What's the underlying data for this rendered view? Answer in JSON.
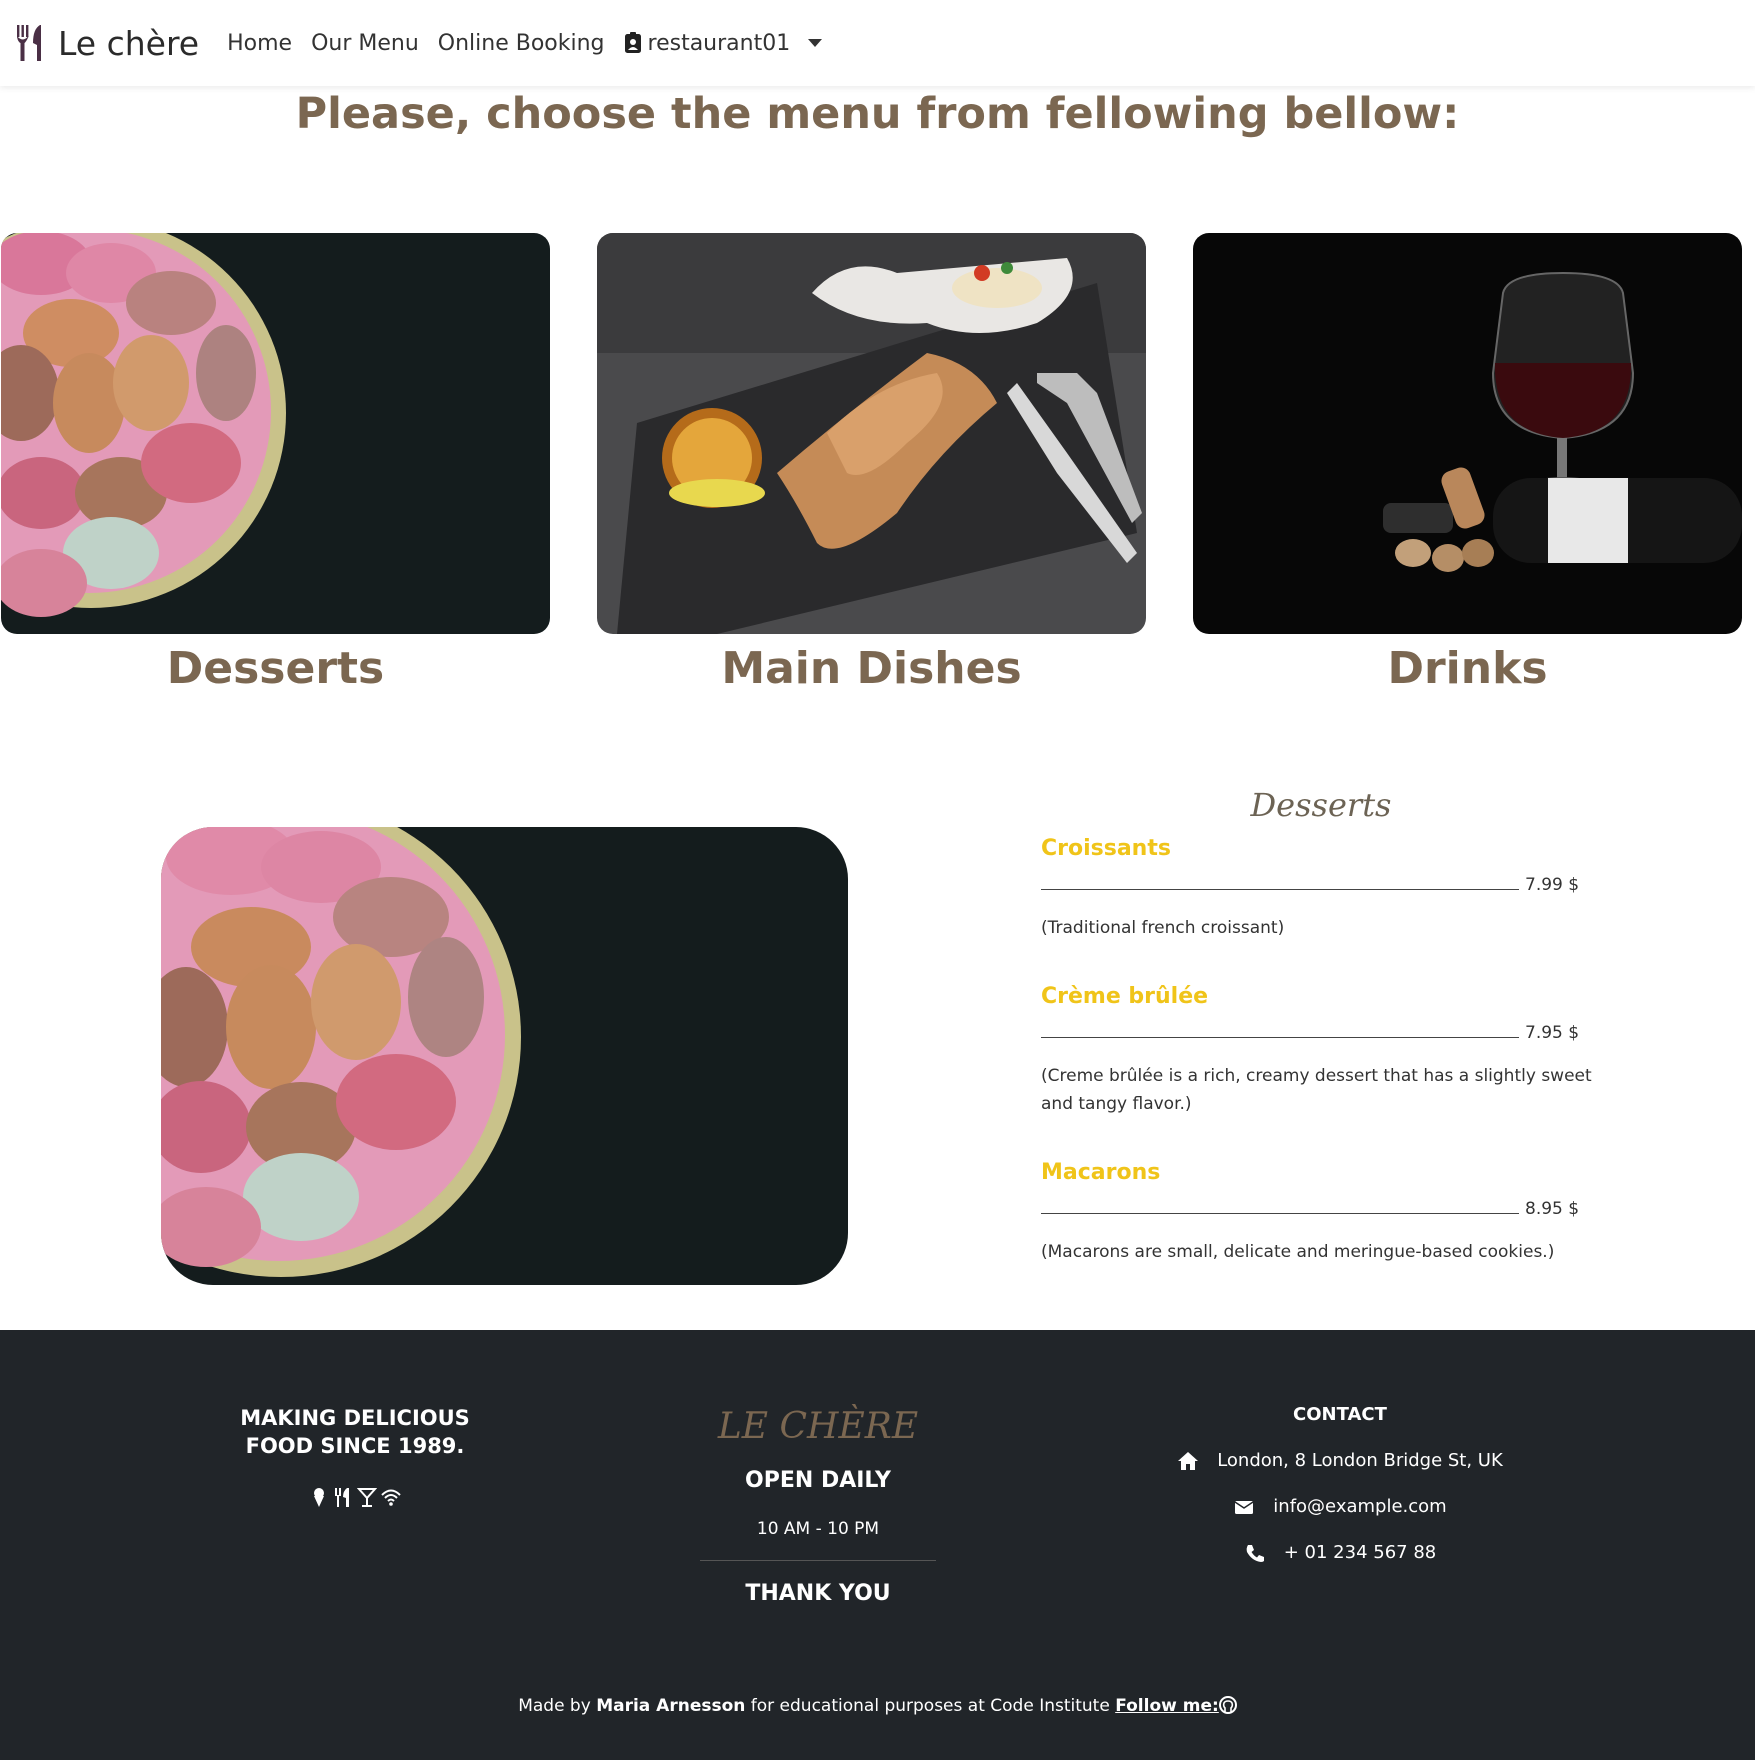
{
  "navbar": {
    "brand": "Le chère",
    "links": [
      "Home",
      "Our Menu",
      "Online Booking"
    ],
    "user": "restaurant01"
  },
  "heading": "Please, choose the menu from fellowing bellow:",
  "categories": [
    {
      "label": "Desserts",
      "image": "macarons-bowl"
    },
    {
      "label": "Main Dishes",
      "image": "grilled-dish-on-slate"
    },
    {
      "label": "Drinks",
      "image": "red-wine-bottle"
    }
  ],
  "menu": {
    "title": "Desserts",
    "items": [
      {
        "name": "Croissants",
        "price": "7.99 $",
        "description": "(Traditional french croissant)"
      },
      {
        "name": "Crème brûlée",
        "price": "7.95 $",
        "description": "(Creme brûlée is a rich, creamy dessert that has a slightly sweet and tangy flavor.)"
      },
      {
        "name": "Macarons",
        "price": "8.95 $",
        "description": "(Macarons are small, delicate and meringue-based cookies.)"
      }
    ]
  },
  "footer": {
    "tagline_line1": "MAKING DELICIOUS",
    "tagline_line2": "FOOD SINCE 1989.",
    "logo": "LE CHÈRE",
    "open_label": "OPEN DAILY",
    "hours": "10 AM - 10 PM",
    "thanks": "THANK YOU",
    "contact_title": "CONTACT",
    "address": "London, 8 London Bridge St, UK",
    "email": "info@example.com",
    "phone": "+ 01 234 567 88",
    "credit_pre": "Made by",
    "credit_name": "Maria Arnesson",
    "credit_mid": "for educational purposes at Code Institute",
    "follow": "Follow me:"
  },
  "colors": {
    "accent_brown": "#7b6751",
    "price_gold": "#f0c419",
    "footer_bg": "#212529",
    "brand_purple": "#4a2f45"
  }
}
